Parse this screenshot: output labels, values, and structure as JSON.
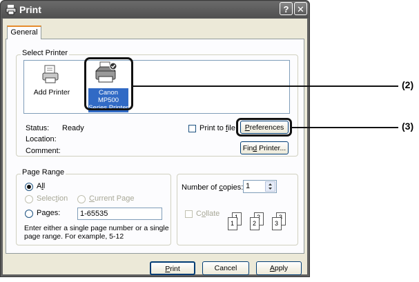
{
  "window": {
    "title": "Print",
    "help_glyph": "?",
    "close_glyph": "✕"
  },
  "tabs": [
    {
      "label": "General"
    }
  ],
  "select_printer": {
    "group_label": "Select Printer",
    "printers": [
      {
        "label": "Add Printer",
        "icon": "add-printer-icon"
      },
      {
        "label_line1": "Canon MP500",
        "label_line2": "Series Printer",
        "icon": "printer-icon",
        "selected": true
      }
    ],
    "status_label": "Status:",
    "status_value": "Ready",
    "location_label": "Location:",
    "comment_label": "Comment:",
    "print_to_file_pre": "Print to ",
    "print_to_file_key": "f",
    "print_to_file_post": "ile",
    "preferences_key": "P",
    "preferences_post": "references",
    "find_printer_pre": "Fin",
    "find_printer_key": "d",
    "find_printer_post": " Printer..."
  },
  "page_range": {
    "group_label": "Page Range",
    "all_pre": "A",
    "all_key": "l",
    "all_post": "l",
    "selection_pre": "Selec",
    "selection_key": "t",
    "selection_post": "ion",
    "current_key": "C",
    "current_post": "urrent Page",
    "pages_pre": "Pa",
    "pages_key": "g",
    "pages_post": "es:",
    "pages_value": "1-65535",
    "hint_line1": "Enter either a single page number or a single",
    "hint_line2": "page range.  For example, 5-12"
  },
  "copies": {
    "label_pre": "Number of ",
    "label_key": "c",
    "label_post": "opies:",
    "value": "1",
    "collate_pre": "C",
    "collate_key": "o",
    "collate_post": "llate",
    "collate_pages": [
      "1",
      "1",
      "2",
      "2",
      "3",
      "3"
    ]
  },
  "footer": {
    "print_key": "P",
    "print_post": "rint",
    "cancel": "Cancel",
    "apply_key": "A",
    "apply_post": "pply"
  },
  "callouts": {
    "two": "(2)",
    "three": "(3)"
  },
  "colors": {
    "titlebar": "#5a5a5a",
    "selection": "#316ac5",
    "tab_accent": "#e68b2c",
    "dialog_bg": "#ece9d8"
  }
}
